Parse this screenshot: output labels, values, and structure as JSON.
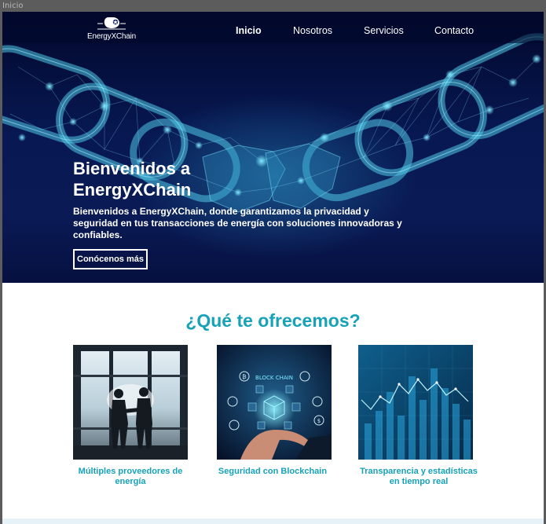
{
  "window": {
    "title": "Inicio"
  },
  "logo": {
    "text": "EnergyXChain"
  },
  "nav": {
    "items": [
      {
        "label": "Inicio",
        "active": true
      },
      {
        "label": "Nosotros",
        "active": false
      },
      {
        "label": "Servicios",
        "active": false
      },
      {
        "label": "Contacto",
        "active": false
      }
    ]
  },
  "hero": {
    "title": "Bienvenidos a EnergyXChain",
    "subtitle": "Bienvenidos a EnergyXChain, donde garantizamos la privacidad y seguridad en tus transacciones de energía con soluciones innovadoras y confiables.",
    "button_label": "Conócenos más",
    "image_text": "BLOCK CHAIN"
  },
  "services": {
    "title": "¿Qué te ofrecemos?",
    "cards": [
      {
        "caption": "Múltiples proveedores de energía",
        "icon": "handshake-image"
      },
      {
        "caption": "Seguridad con Blockchain",
        "icon": "blockchain-image"
      },
      {
        "caption": "Transparencia y estadísticas en tiempo real",
        "icon": "stats-chart-image"
      }
    ]
  },
  "colors": {
    "accent": "#17a2b8",
    "hero_bg": "#071852",
    "text_light": "#ffffff"
  }
}
